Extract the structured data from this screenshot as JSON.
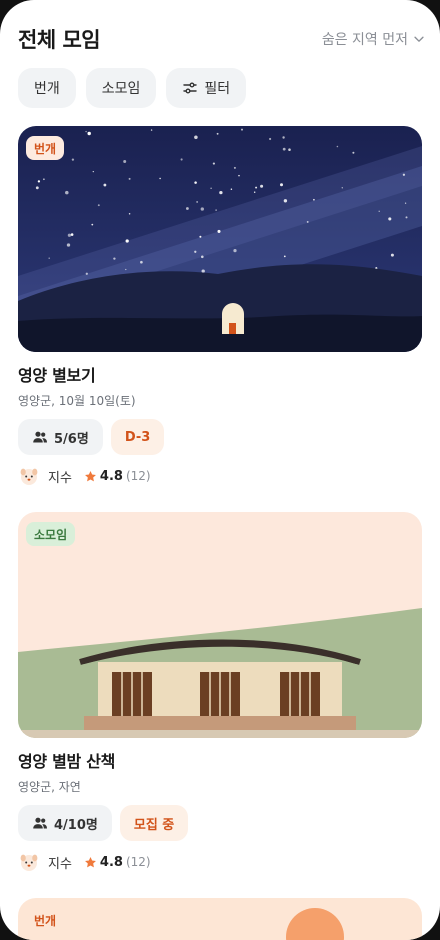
{
  "header": {
    "title": "전체 모임",
    "sort_label": "숨은 지역 먼저"
  },
  "chips": [
    {
      "label": "번개"
    },
    {
      "label": "소모임"
    },
    {
      "label": "필터"
    }
  ],
  "cards": [
    {
      "tag": "번개",
      "title": "영양 별보기",
      "subtitle": "영양군, 10월 10일(토)",
      "members": "5/6명",
      "status": "D-3",
      "host": "지수",
      "rating": "4.8",
      "rating_count": "(12)"
    },
    {
      "tag": "소모임",
      "title": "영양 별밤 산책",
      "subtitle": "영양군, 자연",
      "members": "4/10명",
      "status": "모집 중",
      "host": "지수",
      "rating": "4.8",
      "rating_count": "(12)"
    },
    {
      "tag": "번개"
    }
  ],
  "colors": {
    "accent": "#d2531a",
    "star": "#f07a3c",
    "night": "#1f2a5c"
  },
  "icons": {
    "sort": "chevron-down-icon",
    "filter": "sliders-icon",
    "members": "users-icon",
    "rating": "star-icon"
  }
}
